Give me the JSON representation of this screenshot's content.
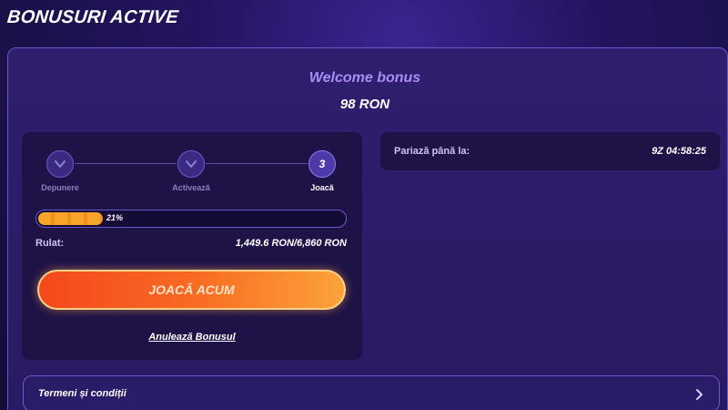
{
  "page": {
    "title": "BONUSURI ACTIVE"
  },
  "bonus": {
    "name": "Welcome bonus",
    "amount": "98 RON"
  },
  "steps": [
    {
      "label": "Depunere",
      "state": "done",
      "icon": "check-chevron-icon"
    },
    {
      "label": "Activează",
      "state": "done",
      "icon": "check-chevron-icon"
    },
    {
      "label": "Joacă",
      "state": "active",
      "number": "3"
    }
  ],
  "progress": {
    "percent_label": "21%",
    "fraction": 0.21,
    "wager_label": "Rulat:",
    "wager_value": "1,449.6 RON/6,860 RON"
  },
  "actions": {
    "play_label": "JOACĂ ACUM",
    "cancel_label": "Anulează Bonusul"
  },
  "deadline": {
    "label": "Pariază până la:",
    "value": "9Z 04:58:25"
  },
  "terms": {
    "label": "Termeni și condiții"
  },
  "colors": {
    "accent": "#a98cf5",
    "progress_fill": "#f7a52a",
    "button_start": "#f4481c",
    "button_end": "#fca33a",
    "panel": "#1e1247"
  }
}
